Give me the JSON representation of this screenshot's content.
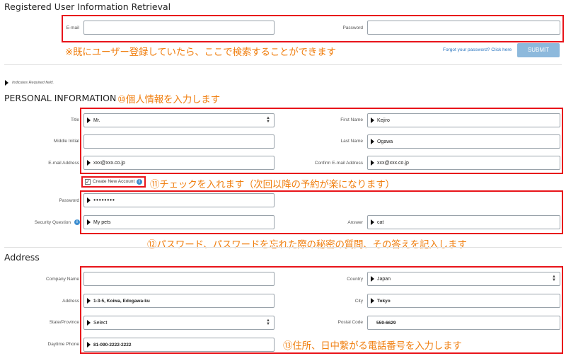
{
  "retrieval": {
    "title": "Registered User Information Retrieval",
    "email_label": "E-mail",
    "email_value": "",
    "password_label": "Password",
    "password_value": "",
    "annotation": "※既にユーザー登録していたら、ここで検索することができます",
    "forgot_link": "Forgot your password? Click here",
    "submit_label": "SUBMIT"
  },
  "required_note": "Indicates Required field.",
  "personal": {
    "title": "PERSONAL INFORMATION",
    "annotation": "⑩個人情報を入力します",
    "title_label": "Title",
    "title_value": "Mr.",
    "first_name_label": "First Name",
    "first_name_value": "Kejiro",
    "middle_initial_label": "Middle Initial",
    "middle_initial_value": "",
    "last_name_label": "Last Name",
    "last_name_value": "Ogawa",
    "email_label": "E-mail Address",
    "email_value": "xxx@xxx.co.jp",
    "confirm_email_label": "Confirm E-mail Address",
    "confirm_email_value": "xxx@xxx.co.jp",
    "create_account_label": "Create New Account",
    "create_account_checked": true,
    "create_account_annotation": "⑪チェックを入れます（次回以降の予約が楽になります）",
    "password_label": "Password",
    "password_value": "●●●●●●●●",
    "security_question_label": "Security Question",
    "security_question_value": "My pets",
    "answer_label": "Answer",
    "answer_value": "cat",
    "password_annotation": "⑫パスワード、パスワードを忘れた際の秘密の質問、その答えを記入します"
  },
  "address": {
    "title": "Address",
    "company_label": "Company Name",
    "company_value": "",
    "country_label": "Country",
    "country_value": "Japan",
    "address_label": "Address",
    "address_value": "1-3-5, Koiwa, Edogawa-ku",
    "city_label": "City",
    "city_value": "Tokyo",
    "state_label": "State/Province",
    "state_value": "Select",
    "postal_label": "Postal Code",
    "postal_value": "559-6629",
    "phone_label": "Daytime Phone",
    "phone_value": "81-090-2222-2222",
    "annotation": "⑬住所、日中繋がる電話番号を入力します"
  },
  "colors": {
    "annotation": "#f07f10",
    "highlight_box": "#e8141a",
    "submit_button": "#8db9dc",
    "link": "#2b76c0"
  }
}
